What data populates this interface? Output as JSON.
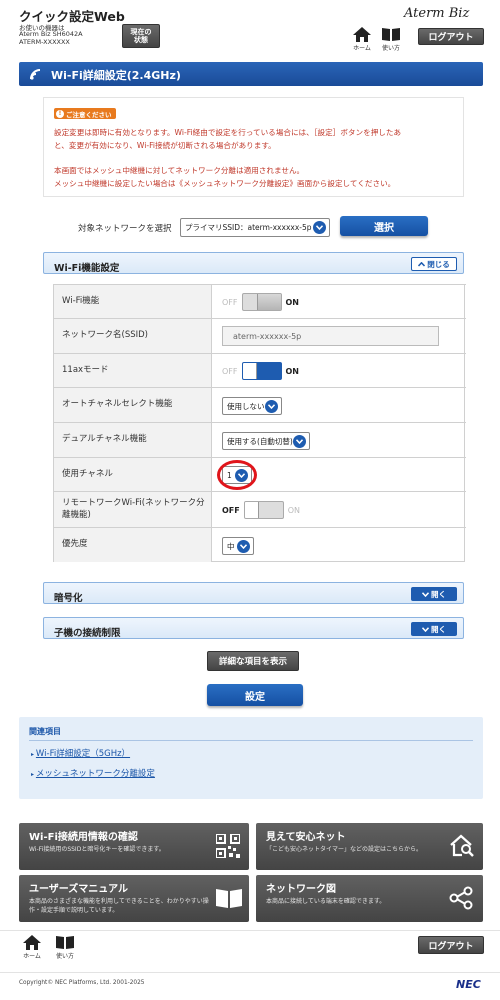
{
  "header": {
    "app_title": "クイック設定Web",
    "device_label": "お使いの機器は",
    "device_model": "Aterm Biz SH6042A",
    "device_id": "ATERM-XXXXXX",
    "status_button": "現在の\n状態",
    "home_label": "ホーム",
    "help_label": "使い方",
    "logout_label": "ログアウト",
    "brand_logo": "Aterm Biz"
  },
  "page": {
    "title": "Wi-Fi詳細設定(2.4GHz)"
  },
  "notice": {
    "badge": "ご注意ください",
    "line1": "設定変更は即時に有効となります。Wi-Fi経由で設定を行っている場合には、［設定］ボタンを押したあ",
    "line2": "と、変更が有効になり、Wi-Fi接続が切断される場合があります。",
    "line3": "本画面ではメッシュ中継機に対してネットワーク分離は適用されません。",
    "line4": "メッシュ中継機に設定したい場合は《メッシュネットワーク分離設定》画面から設定してください。"
  },
  "network_select": {
    "label": "対象ネットワークを選択",
    "value": "プライマリSSID：aterm-xxxxxx-5p",
    "button": "選択"
  },
  "wifi_section": {
    "title": "Wi-Fi機能設定",
    "toggle_label": "閉じる",
    "rows": {
      "wifi": {
        "label": "Wi-Fi機能",
        "off": "OFF",
        "on": "ON",
        "state": "on"
      },
      "ssid": {
        "label": "ネットワーク名(SSID)",
        "value": "aterm-xxxxxx-5p"
      },
      "ax": {
        "label": "11axモード",
        "off": "OFF",
        "on": "ON",
        "state": "on"
      },
      "autoch": {
        "label": "オートチャネルセレクト機能",
        "value": "使用しない"
      },
      "dual": {
        "label": "デュアルチャネル機能",
        "value": "使用する(自動切替)"
      },
      "channel": {
        "label": "使用チャネル",
        "value": "1"
      },
      "remote": {
        "label": "リモートワークWi-Fi(ネットワーク分離機能)",
        "off": "OFF",
        "on": "ON",
        "state": "off"
      },
      "priority": {
        "label": "優先度",
        "value": "中"
      }
    }
  },
  "encryption_section": {
    "title": "暗号化",
    "toggle_label": "開く"
  },
  "client_section": {
    "title": "子機の接続制限",
    "toggle_label": "開く"
  },
  "buttons": {
    "show_details": "詳細な項目を表示",
    "apply": "設定"
  },
  "related": {
    "title": "関連項目",
    "link1": "Wi-Fi詳細設定（5GHz）",
    "link2": "メッシュネットワーク分離設定"
  },
  "tiles": [
    {
      "title": "Wi-Fi接続用情報の確認",
      "sub1": "Wi-Fi接続用のSSIDと暗号化キーを確認できます。",
      "sub2": "",
      "icon": "qr-code-icon"
    },
    {
      "title": "見えて安心ネット",
      "sub1": "「こども安心ネットタイマー」などの設定はこちらから。",
      "sub2": "",
      "icon": "house-search-icon"
    },
    {
      "title": "ユーザーズマニュアル",
      "sub1": "本商品のさまざまな機能を利用してできることを、わかりやすい操",
      "sub2": "作・設定手順で説明しています。",
      "icon": "book-icon"
    },
    {
      "title": "ネットワーク図",
      "sub1": "本商品に接続している端末を確認できます。",
      "sub2": "",
      "icon": "share-network-icon"
    }
  ],
  "footer": {
    "home_label": "ホーム",
    "help_label": "使い方",
    "logout_label": "ログアウト",
    "copyright": "Copyright© NEC Platforms, Ltd. 2001-2025",
    "nec_logo": "NEC"
  },
  "colors": {
    "accent_blue": "#1e5cb0",
    "title_bar": "#1f56a9",
    "notice_red": "#c0392b",
    "highlight_circle": "#e0151b"
  }
}
